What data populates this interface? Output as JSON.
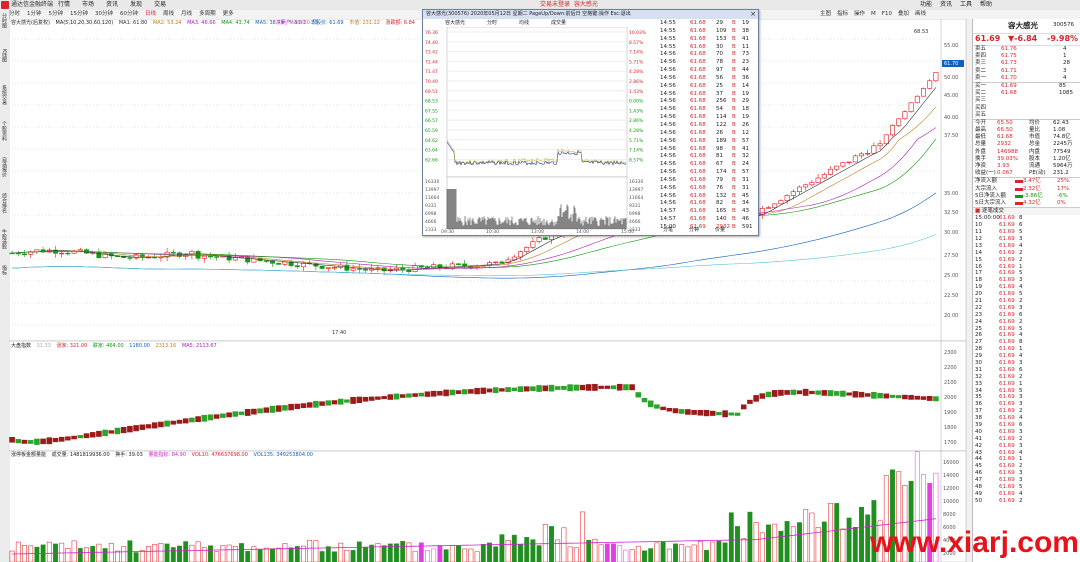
{
  "titlebar": {
    "app": "通达信金融终端",
    "menu": [
      "行情",
      "市场",
      "资讯",
      "发现",
      "交易"
    ],
    "center": "交易未登录",
    "center2": "容大感光",
    "right": [
      "功能",
      "资讯",
      "工具",
      "帮助"
    ]
  },
  "toolbar": {
    "items": [
      "分时",
      "1分钟",
      "5分钟",
      "15分钟",
      "30分钟",
      "60分钟",
      "日线",
      "周线",
      "月线",
      "多周期",
      "更多"
    ],
    "active": "日线",
    "right": [
      "主图",
      "指标",
      "操作",
      "M",
      "F10",
      "叠加",
      "画线"
    ]
  },
  "leftside": [
    "分时图",
    "K线图",
    "系统交易",
    "个股资料",
    "自选报价",
    "综合排名",
    "牛股选股",
    "指标"
  ],
  "main_legend": {
    "name": "容大感光(后复权)",
    "ma": "MA(5,10,20,30,60,120)",
    "ma1": "MA1: 61.80",
    "ma2": "MA2: 53.24",
    "ma3": "MA3: 46.66",
    "ma4": "MA4: 43.74",
    "ma5": "MA5: 38.79",
    "ma6": "MA6: 30.73",
    "extra1": "东吴产: 3.80",
    "extra2": "现股价: 61.69",
    "extra3": "市值: 231.22",
    "extra4": "涨跌额: 6.84"
  },
  "index_legend": {
    "name": "大盘指数",
    "v1": "31.33",
    "v2": "涨家: 321.00",
    "v3": "跌家: 464.00",
    "v4": "1180.00",
    "v5": "2313.16",
    "v6": "MA5: 2113.67"
  },
  "vol_legend": {
    "name": "涨停板金额量能",
    "a": "成交量: 1481819936.00",
    "b": "换手: 39.03",
    "c": "量能指标: 84.90",
    "d": "VOL10: 476637698.00",
    "e": "VOL135: 340253804.00"
  },
  "price_axis": [
    "61.70",
    "55.00",
    "50.00",
    "45.00",
    "40.00",
    "37.50",
    "35.00",
    "32.50",
    "30.00",
    "27.50",
    "25.00",
    "22.50",
    "20.00"
  ],
  "index_axis": [
    "2300",
    "2200",
    "2100",
    "2000",
    "1900",
    "1800",
    "1700"
  ],
  "vol_axis": [
    "16000",
    "14000",
    "12000",
    "10000",
    "8000",
    "6000",
    "4000",
    "2000"
  ],
  "labels": {
    "low": "17.40",
    "high": "68.53",
    "cur": "61.70"
  },
  "popup": {
    "title": "容大感光(300576) 2020年05月12日 星期二 PageUp/Down:前后日 空格键:操作 Esc:退出",
    "tabs": [
      "容大感光",
      "分时",
      "均线",
      "成交量"
    ],
    "close": "×",
    "left_axis": [
      "76.36",
      "74.40",
      "73.42",
      "72.44",
      "71.47",
      "70.49",
      "69.51",
      "68.53",
      "67.55",
      "66.57",
      "65.59",
      "64.62",
      "63.64",
      "62.66"
    ],
    "right_axis": [
      "10.03%",
      "8.57%",
      "7.14%",
      "5.71%",
      "4.28%",
      "2.86%",
      "1.43%",
      "0.00%",
      "1.43%",
      "2.86%",
      "4.28%",
      "5.71%",
      "7.14%",
      "8.57%"
    ],
    "vol_axis": [
      "16330",
      "13997",
      "11664",
      "9331",
      "6998",
      "4666",
      "2333"
    ],
    "times": [
      "09:30",
      "10:30",
      "13:00",
      "14:00",
      "15:00"
    ],
    "bottom": [
      "分笔",
      "分钟",
      "价量"
    ]
  },
  "ticks": [
    [
      "14:55",
      "61.68",
      "29",
      "B",
      "19"
    ],
    [
      "14:55",
      "61.68",
      "109",
      "B",
      "38"
    ],
    [
      "14:55",
      "61.68",
      "153",
      "B",
      "41"
    ],
    [
      "14:55",
      "61.68",
      "30",
      "B",
      "11"
    ],
    [
      "14:56",
      "61.68",
      "70",
      "B",
      "73"
    ],
    [
      "14:56",
      "61.68",
      "78",
      "B",
      "23"
    ],
    [
      "14:56",
      "61.68",
      "97",
      "B",
      "44"
    ],
    [
      "14:56",
      "61.68",
      "56",
      "B",
      "36"
    ],
    [
      "14:56",
      "61.68",
      "25",
      "B",
      "14"
    ],
    [
      "14:56",
      "61.68",
      "37",
      "B",
      "19"
    ],
    [
      "14:56",
      "61.68",
      "256",
      "B",
      "29"
    ],
    [
      "14:56",
      "61.68",
      "54",
      "B",
      "18"
    ],
    [
      "14:56",
      "61.68",
      "114",
      "B",
      "19"
    ],
    [
      "14:56",
      "61.68",
      "122",
      "B",
      "26"
    ],
    [
      "14:56",
      "61.68",
      "26",
      "B",
      "12"
    ],
    [
      "14:56",
      "61.68",
      "189",
      "B",
      "57"
    ],
    [
      "14:56",
      "61.68",
      "98",
      "B",
      "41"
    ],
    [
      "14:56",
      "61.68",
      "81",
      "B",
      "32"
    ],
    [
      "14:56",
      "61.68",
      "67",
      "B",
      "24"
    ],
    [
      "14:56",
      "61.68",
      "174",
      "B",
      "57"
    ],
    [
      "14:56",
      "61.68",
      "79",
      "B",
      "31"
    ],
    [
      "14:56",
      "61.68",
      "76",
      "B",
      "31"
    ],
    [
      "14:56",
      "61.68",
      "132",
      "B",
      "45"
    ],
    [
      "14:56",
      "61.68",
      "82",
      "B",
      "34"
    ],
    [
      "14:57",
      "61.68",
      "165",
      "B",
      "43"
    ],
    [
      "14:57",
      "61.68",
      "140",
      "B",
      "46"
    ],
    [
      "15:00",
      "61.69",
      "2932",
      "B",
      "591"
    ]
  ],
  "rpanel": {
    "name": "容大感光",
    "code": "300576",
    "price": "61.69",
    "change": "▼-6.84",
    "pct": "-9.98%",
    "sell": [
      [
        "卖五",
        "61.76",
        "4"
      ],
      [
        "卖四",
        "61.75",
        "1"
      ],
      [
        "卖三",
        "61.73",
        "28"
      ],
      [
        "卖二",
        "61.71",
        "3"
      ],
      [
        "卖一",
        "61.70",
        "4"
      ]
    ],
    "buy": [
      [
        "买一",
        "61.69",
        "85"
      ],
      [
        "买二",
        "61.68",
        "1085"
      ],
      [
        "买三",
        "",
        ""
      ],
      [
        "买四",
        "",
        ""
      ],
      [
        "买五",
        "",
        ""
      ]
    ],
    "stats": [
      [
        "今开",
        "65.50",
        "均价",
        "62.43"
      ],
      [
        "最高",
        "66.50",
        "量比",
        "1.08"
      ],
      [
        "最低",
        "61.68",
        "市值",
        "74.8亿"
      ],
      [
        "总量",
        "2932",
        "总金",
        "2245万"
      ],
      [
        "外盘",
        "146988",
        "内盘",
        "77549"
      ],
      [
        "换手",
        "39.03%",
        "股本",
        "1.20亿"
      ],
      [
        "净资",
        "3.93",
        "流通",
        "5964万"
      ],
      [
        "收益(一)",
        "0.067",
        "PE(动)",
        "231.2"
      ]
    ],
    "flow": [
      [
        "净流入额",
        "3.47亿",
        "25%"
      ],
      [
        "大宗流入",
        "2.32亿",
        "17%"
      ],
      [
        "5日净流入额",
        "-3.86亿",
        "-6%"
      ],
      [
        "5日大宗流入",
        "4.32亿",
        "0%"
      ]
    ],
    "trade_title": "逐笔成交",
    "trades": [
      [
        "15:00:00",
        "61.69",
        "8"
      ],
      [
        "10",
        "61.69",
        "6"
      ],
      [
        "11",
        "61.69",
        "5"
      ],
      [
        "12",
        "61.69",
        "3"
      ],
      [
        "13",
        "61.69",
        "4"
      ],
      [
        "14",
        "61.69",
        "2"
      ],
      [
        "15",
        "61.69",
        "2"
      ],
      [
        "16",
        "61.69",
        "1"
      ],
      [
        "17",
        "61.69",
        "5"
      ],
      [
        "18",
        "61.69",
        "3"
      ],
      [
        "19",
        "61.69",
        "4"
      ],
      [
        "20",
        "61.69",
        "5"
      ],
      [
        "21",
        "61.69",
        "2"
      ],
      [
        "22",
        "61.69",
        "3"
      ],
      [
        "23",
        "61.69",
        "6"
      ],
      [
        "24",
        "61.69",
        "2"
      ],
      [
        "25",
        "61.69",
        "5"
      ],
      [
        "26",
        "61.69",
        "4"
      ],
      [
        "27",
        "61.69",
        "8"
      ],
      [
        "28",
        "61.69",
        "1"
      ],
      [
        "29",
        "61.69",
        "4"
      ],
      [
        "30",
        "61.69",
        "3"
      ],
      [
        "31",
        "61.69",
        "6"
      ],
      [
        "32",
        "61.69",
        "2"
      ],
      [
        "33",
        "61.69",
        "1"
      ],
      [
        "34",
        "61.69",
        "5"
      ],
      [
        "35",
        "61.69",
        "3"
      ],
      [
        "36",
        "61.69",
        "3"
      ],
      [
        "37",
        "61.69",
        "2"
      ],
      [
        "38",
        "61.69",
        "4"
      ],
      [
        "39",
        "61.69",
        "6"
      ],
      [
        "40",
        "61.69",
        "3"
      ],
      [
        "41",
        "61.69",
        "2"
      ],
      [
        "42",
        "61.69",
        "3"
      ],
      [
        "43",
        "61.69",
        "4"
      ],
      [
        "44",
        "61.69",
        "1"
      ],
      [
        "45",
        "61.69",
        "2"
      ],
      [
        "46",
        "61.69",
        "3"
      ],
      [
        "47",
        "61.69",
        "3"
      ],
      [
        "48",
        "61.69",
        "5"
      ],
      [
        "49",
        "61.69",
        "4"
      ],
      [
        "50",
        "61.69",
        "2"
      ]
    ]
  },
  "watermark": "www.xiarj.com",
  "colors": {
    "up": "#e8121b",
    "down": "#109a10",
    "accent": "#d8262c"
  }
}
